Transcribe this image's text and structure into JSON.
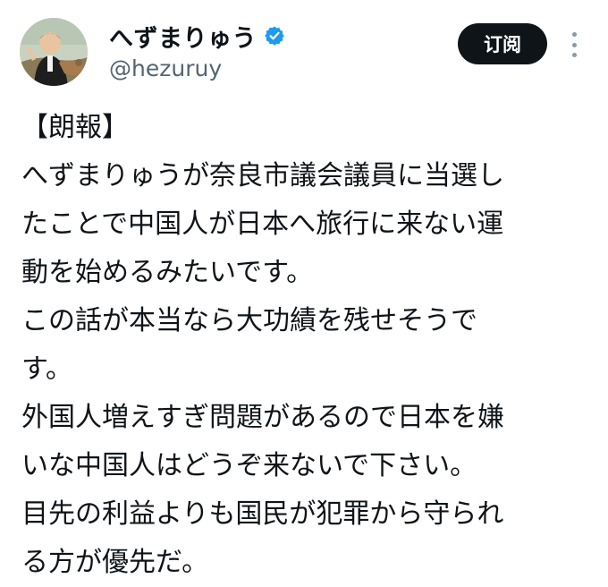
{
  "author": {
    "display_name": "へずまりゅう",
    "handle": "@hezuruy",
    "verified": true,
    "verified_color": "#1d9bf0"
  },
  "actions": {
    "subscribe_label": "订阅",
    "more_icon": "more-vertical-icon"
  },
  "tweet": {
    "lines": [
      "【朗報】",
      "へずまりゅうが奈良市議会議員に当選し",
      "たことで中国人が日本へ旅行に来ない運",
      "動を始めるみたいです。",
      "この話が本当なら大功績を残せそうで",
      "す。",
      "外国人増えすぎ問題があるので日本を嫌",
      "いな中国人はどうぞ来ないで下さい。",
      "目先の利益よりも国民が犯罪から守られ",
      "る方が優先だ。"
    ]
  },
  "colors": {
    "text": "#0f1419",
    "secondary_text": "#536471",
    "button_bg": "#0f1419",
    "button_text": "#ffffff"
  }
}
